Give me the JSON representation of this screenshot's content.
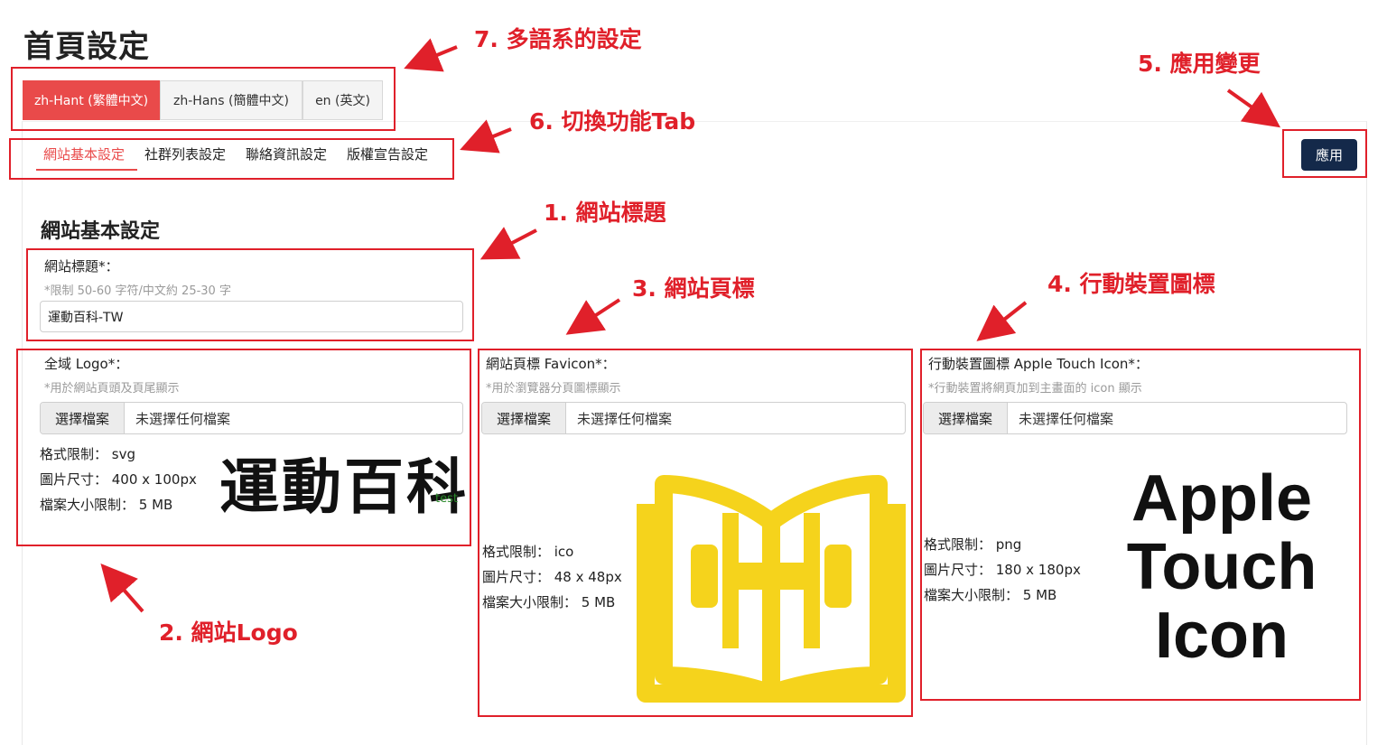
{
  "page_title": "首頁設定",
  "language_tabs": [
    {
      "label": "zh-Hant (繁體中文)",
      "active": true
    },
    {
      "label": "zh-Hans (簡體中文)",
      "active": false
    },
    {
      "label": "en (英文)",
      "active": false
    }
  ],
  "sub_tabs": [
    {
      "label": "網站基本設定",
      "active": true
    },
    {
      "label": "社群列表設定",
      "active": false
    },
    {
      "label": "聯絡資訊設定",
      "active": false
    },
    {
      "label": "版權宣告設定",
      "active": false
    }
  ],
  "apply_button": "應用",
  "section_title": "網站基本設定",
  "site_title": {
    "label": "網站標題*：",
    "hint": "*限制 50-60 字符/中文約 25-30 字",
    "value": "運動百科-TW"
  },
  "logo": {
    "label": "全域 Logo*：",
    "hint": "*用於網站頁頭及頁尾顯示",
    "file_button": "選擇檔案",
    "file_status": "未選擇任何檔案",
    "format": "格式限制： svg",
    "size": "圖片尺寸： 400 x 100px",
    "max_filesize": "檔案大小限制： 5 MB",
    "preview_text": "運動百科",
    "preview_small": "test"
  },
  "favicon": {
    "label": "網站頁標 Favicon*：",
    "hint": "*用於瀏覽器分頁圖標顯示",
    "file_button": "選擇檔案",
    "file_status": "未選擇任何檔案",
    "format": "格式限制： ico",
    "size": "圖片尺寸： 48 x 48px",
    "max_filesize": "檔案大小限制： 5 MB"
  },
  "apple_icon": {
    "label": "行動裝置圖標 Apple Touch Icon*：",
    "hint": "*行動裝置將網頁加到主畫面的 icon 顯示",
    "file_button": "選擇檔案",
    "file_status": "未選擇任何檔案",
    "format": "格式限制： png",
    "size": "圖片尺寸： 180 x 180px",
    "max_filesize": "檔案大小限制： 5 MB",
    "preview_lines": [
      "Apple",
      "Touch",
      "Icon"
    ]
  },
  "annotations": {
    "a1": "1. 網站標題",
    "a2": "2. 網站Logo",
    "a3": "3. 網站頁標",
    "a4": "4. 行動裝置圖標",
    "a5": "5. 應用變更",
    "a6": "6. 切換功能Tab",
    "a7": "7. 多語系的設定"
  },
  "colors": {
    "accent_red": "#e94a4a",
    "annotation_red": "#e0202a",
    "apply_navy": "#14294a",
    "favicon_yellow": "#f5d31c"
  }
}
